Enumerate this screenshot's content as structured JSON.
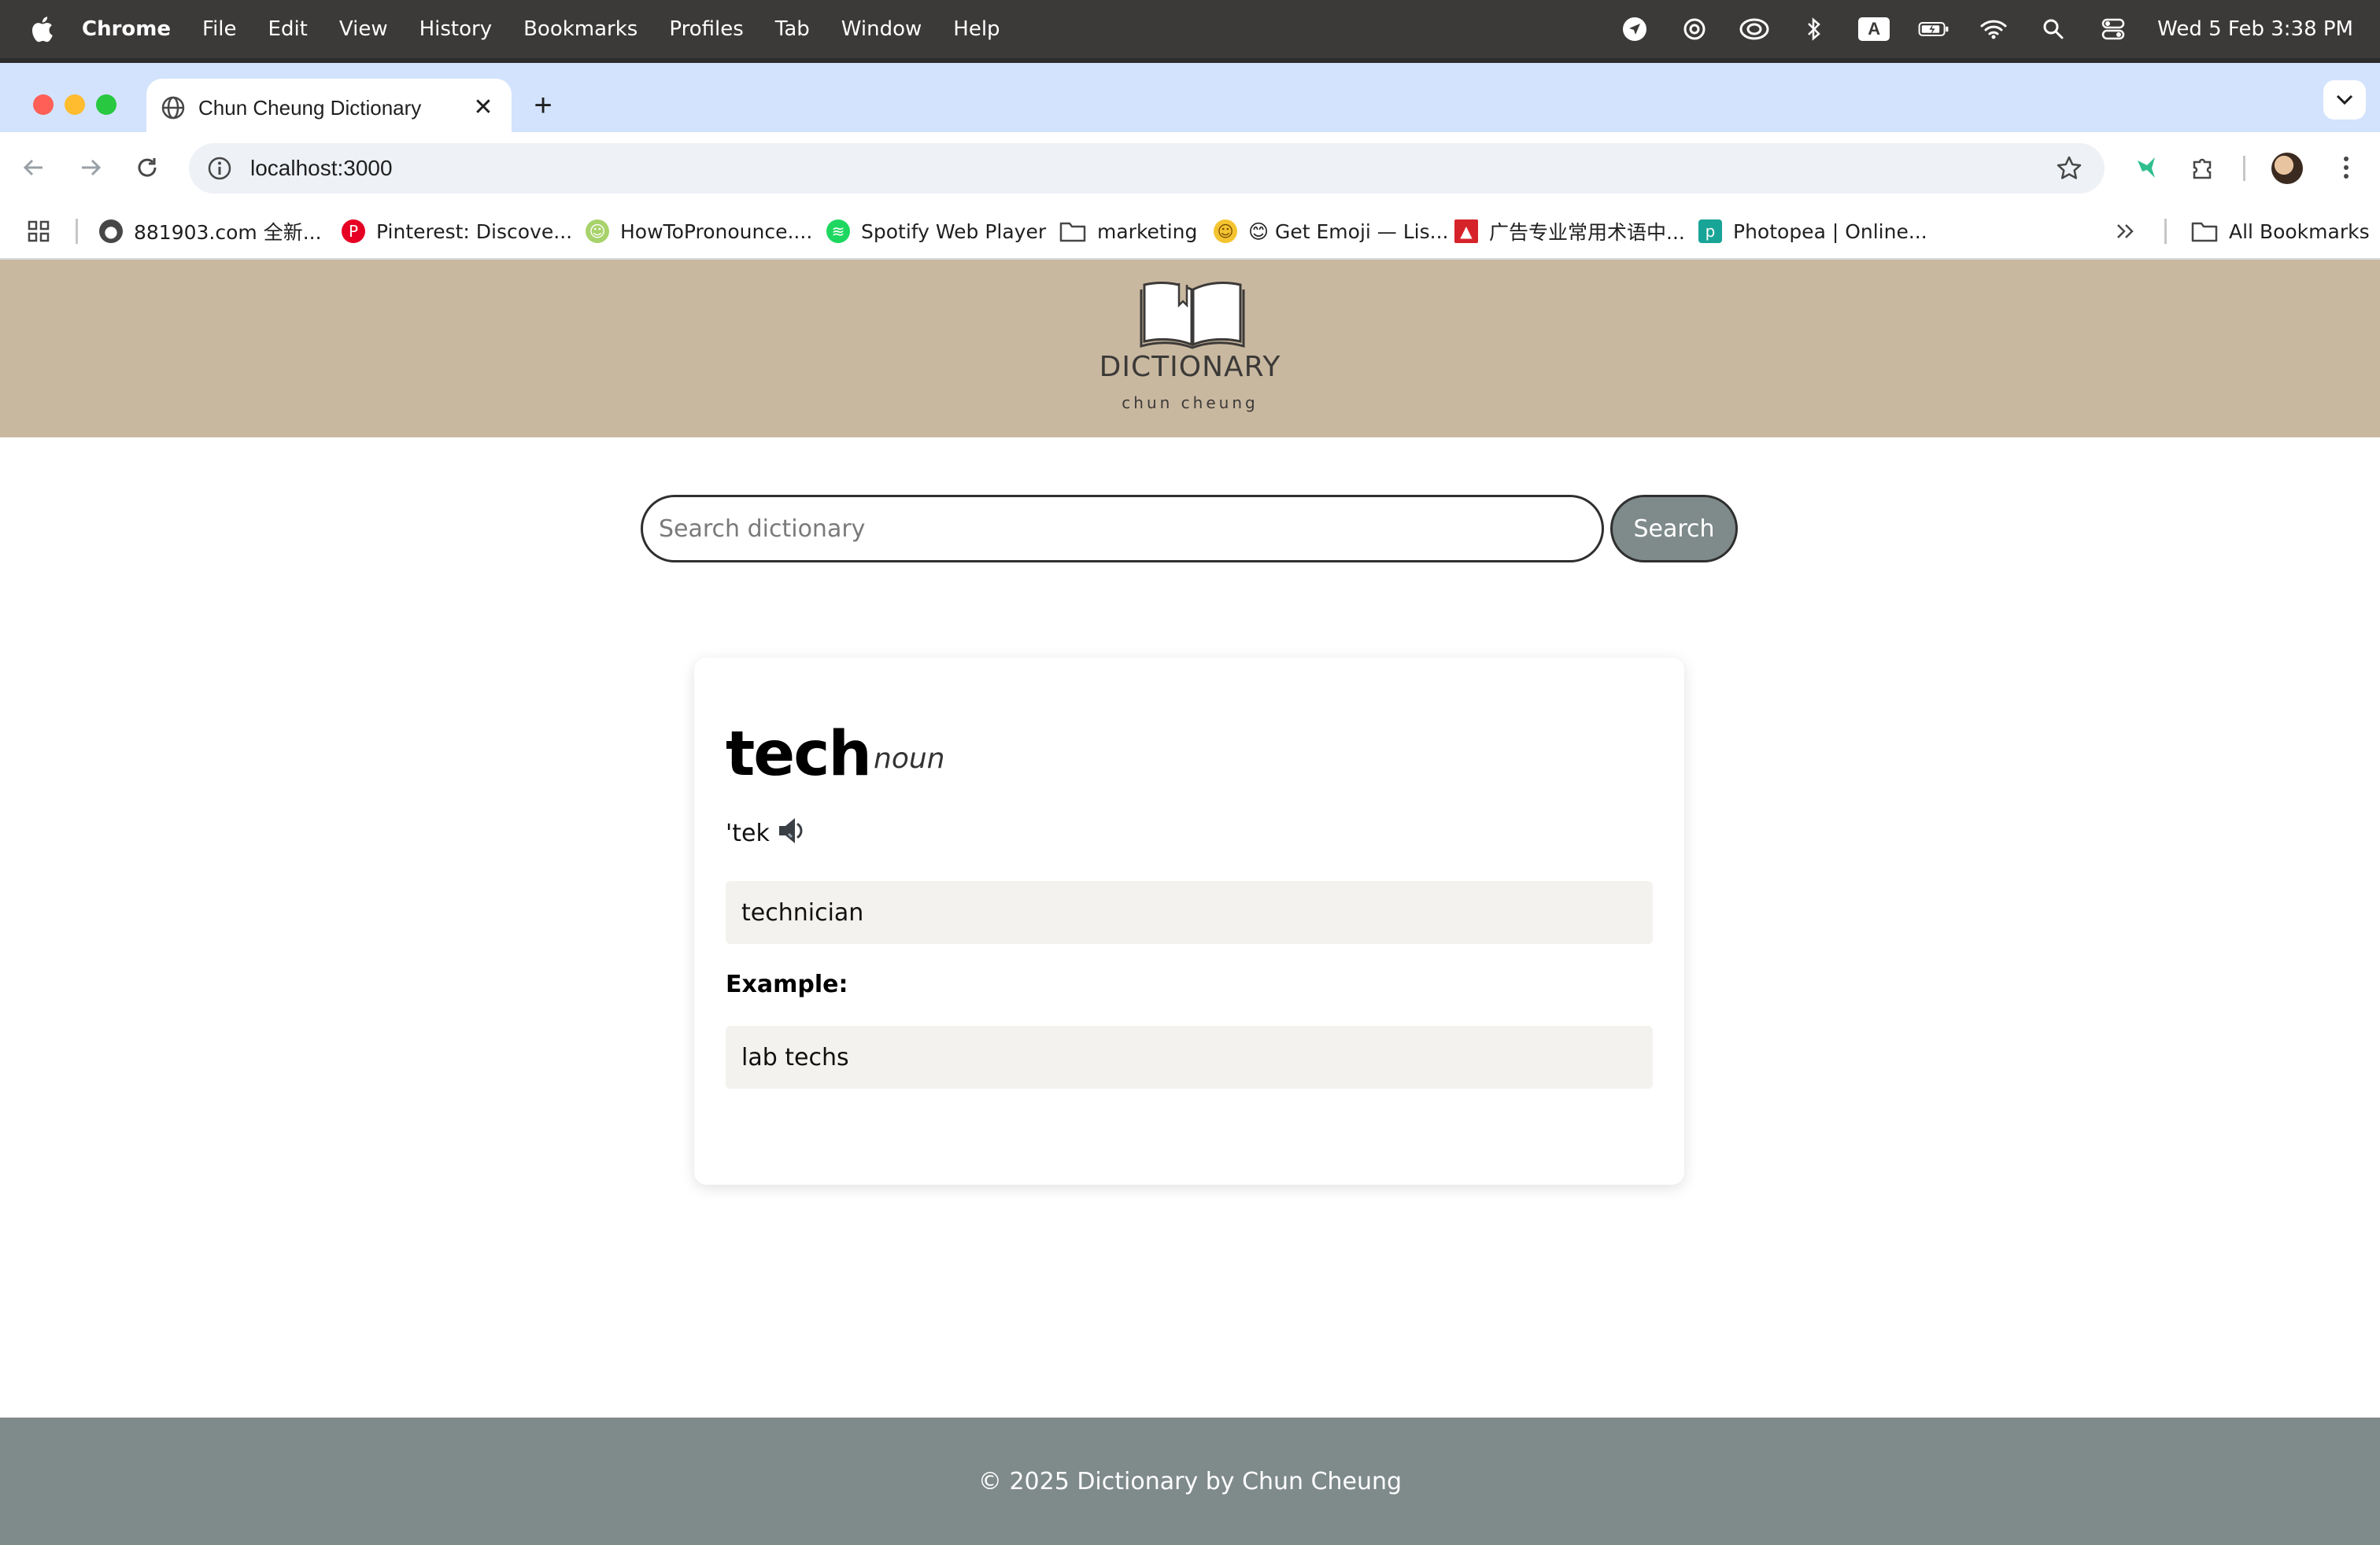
{
  "menubar": {
    "app_name": "Chrome",
    "items": [
      "File",
      "Edit",
      "View",
      "History",
      "Bookmarks",
      "Profiles",
      "Tab",
      "Window",
      "Help"
    ],
    "keyboard_indicator": "A",
    "clock": "Wed 5 Feb  3:38 PM"
  },
  "browser": {
    "tab_title": "Chun Cheung Dictionary",
    "url": "localhost:3000",
    "bookmarks": [
      {
        "label": "881903.com 全新...",
        "icon": "globe-icon"
      },
      {
        "label": "Pinterest: Discove...",
        "icon": "pinterest-icon",
        "color": "#e60023"
      },
      {
        "label": "HowToPronounce....",
        "icon": "howtopronounce-icon",
        "color": "#a8d26b"
      },
      {
        "label": "Spotify Web Player",
        "icon": "spotify-icon",
        "color": "#1ed760"
      },
      {
        "label": "marketing",
        "icon": "folder-icon"
      },
      {
        "label": "😊 Get Emoji — Lis...",
        "icon": "emoji-icon"
      },
      {
        "label": "广告专业常用术语中...",
        "icon": "site-icon"
      },
      {
        "label": "Photopea | Online...",
        "icon": "photopea-icon",
        "color": "#18a497"
      }
    ],
    "all_bookmarks": "All Bookmarks"
  },
  "header": {
    "title": "DICTIONARY",
    "subtitle": "chun cheung",
    "background": "#c9b8a0"
  },
  "search": {
    "placeholder": "Search dictionary",
    "value": "",
    "button_label": "Search"
  },
  "result": {
    "word": "tech",
    "part_of_speech": "noun",
    "phonetic": "'tek",
    "definition": "technician",
    "example_label": "Example:",
    "example": "lab techs"
  },
  "footer": {
    "text": "© 2025 Dictionary by Chun Cheung",
    "background": "#7f8a8a"
  }
}
